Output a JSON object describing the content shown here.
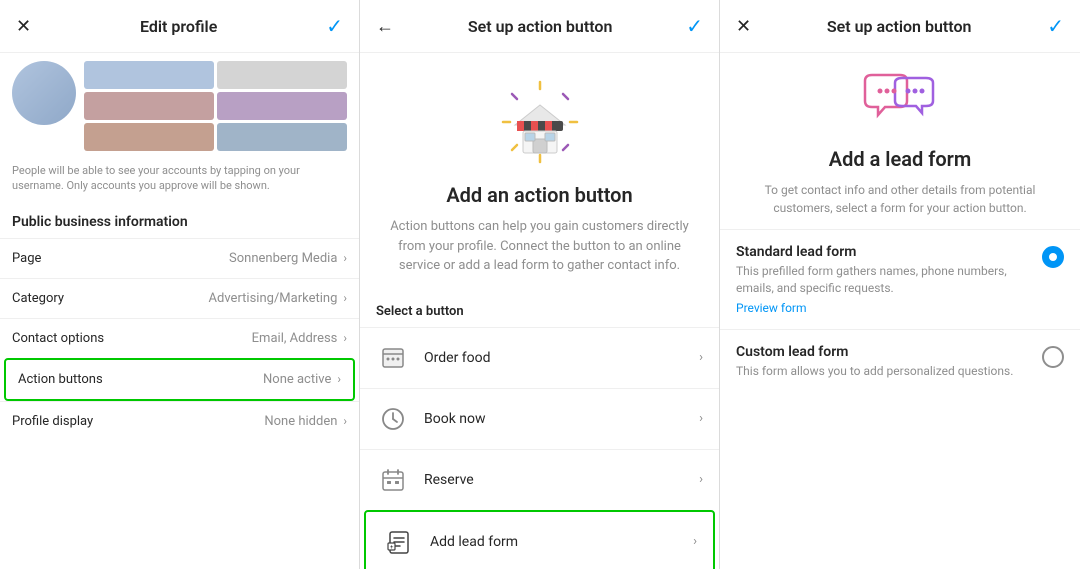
{
  "panel1": {
    "header": {
      "close_label": "✕",
      "title": "Edit profile",
      "check_label": "✓"
    },
    "profile_desc": "People will be able to see your accounts by tapping on your username. Only accounts you approve will be shown.",
    "section_label": "Public business information",
    "items": [
      {
        "label": "Page",
        "value": "Sonnenberg Media",
        "has_chevron": true
      },
      {
        "label": "Category",
        "value": "Advertising/Marketing",
        "has_chevron": true
      },
      {
        "label": "Contact options",
        "value": "Email, Address",
        "has_chevron": true
      },
      {
        "label": "Action buttons",
        "value": "None active",
        "has_chevron": true,
        "highlighted": true
      },
      {
        "label": "Profile display",
        "value": "None hidden",
        "has_chevron": true
      }
    ]
  },
  "panel2": {
    "header": {
      "back_label": "←",
      "title": "Set up action button",
      "check_label": "✓"
    },
    "hero_title": "Add an action button",
    "hero_desc": "Action buttons can help you gain customers directly from your profile. Connect the button to an online service or add a lead form to gather contact info.",
    "select_label": "Select a button",
    "items": [
      {
        "label": "Order food",
        "icon": "🍽"
      },
      {
        "label": "Book now",
        "icon": "🕐"
      },
      {
        "label": "Reserve",
        "icon": "📅"
      },
      {
        "label": "Add lead form",
        "icon": "📋",
        "highlighted": true
      }
    ]
  },
  "panel3": {
    "header": {
      "close_label": "✕",
      "title": "Set up action button",
      "check_label": "✓"
    },
    "hero_title": "Add a lead form",
    "hero_desc": "To get contact info and other details from potential customers, select a form for your action button.",
    "forms": [
      {
        "title": "Standard lead form",
        "desc": "This prefilled form gathers names, phone numbers, emails, and specific requests.",
        "link": "Preview form",
        "selected": true
      },
      {
        "title": "Custom lead form",
        "desc": "This form allows you to add personalized questions.",
        "link": null,
        "selected": false
      }
    ]
  },
  "icons": {
    "chevron": "›",
    "radio_filled": "●",
    "radio_empty": "○"
  }
}
